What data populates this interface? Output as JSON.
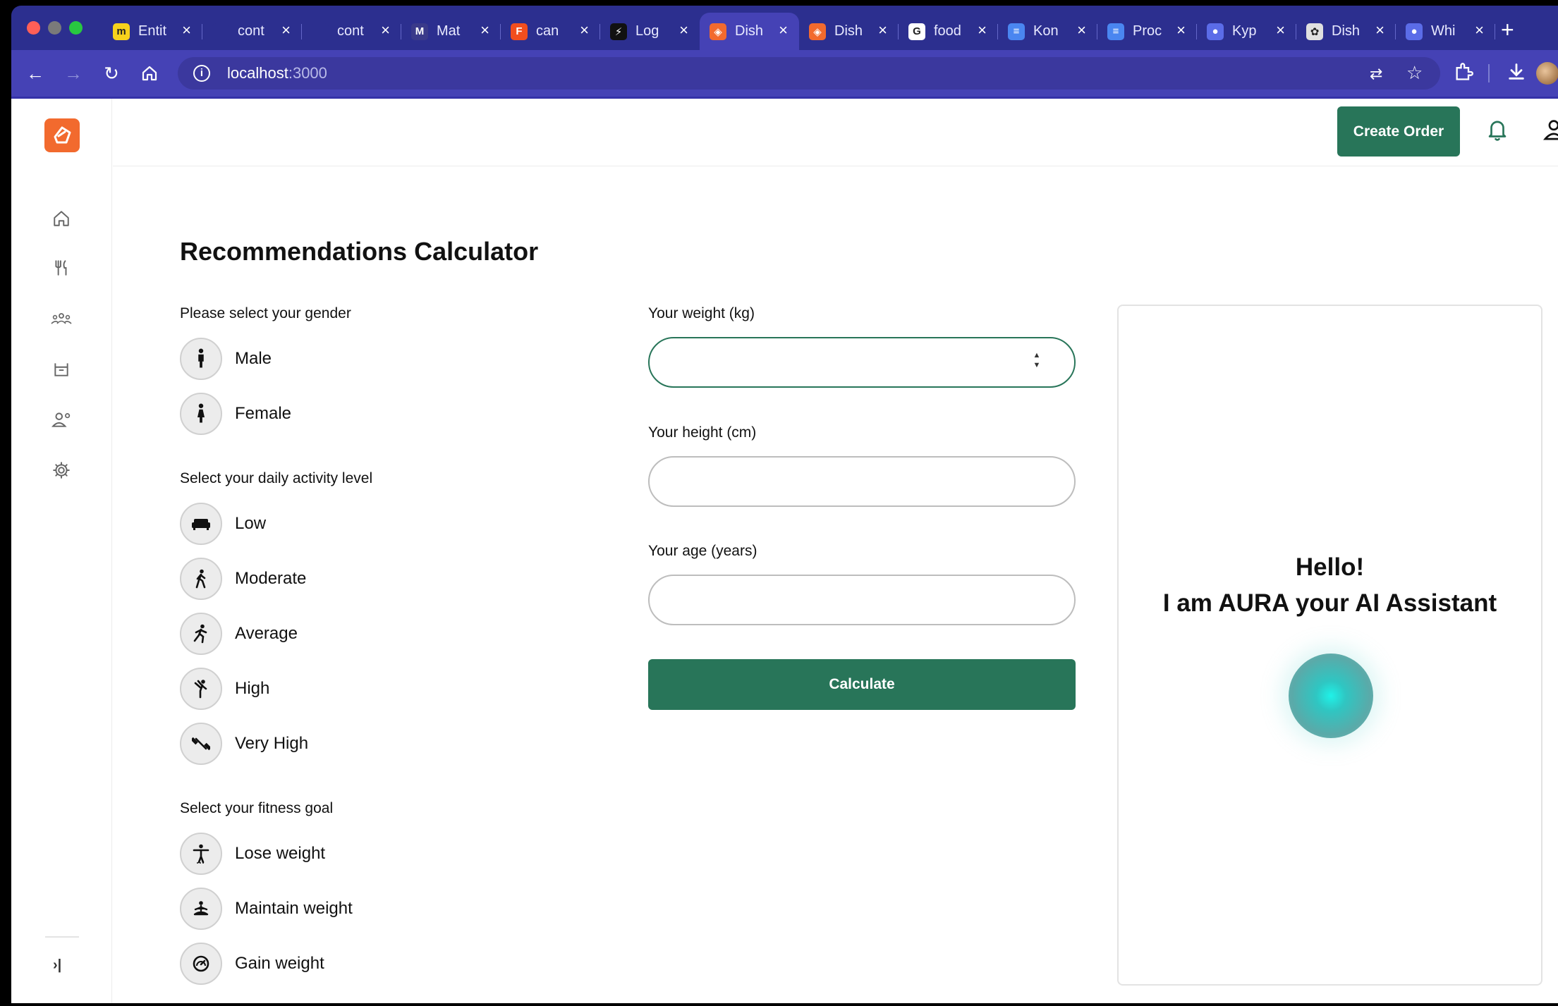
{
  "browser": {
    "tabs": [
      {
        "title": "Entit",
        "favicon": "miro-icon",
        "fav_color": "#f7d21c",
        "fav_text": "m"
      },
      {
        "title": "cont",
        "favicon": "notion-like-icon",
        "fav_color": "#2c2f8f",
        "fav_text": ""
      },
      {
        "title": "cont",
        "favicon": "notion-like-icon",
        "fav_color": "#2c2f8f",
        "fav_text": ""
      },
      {
        "title": "Mat",
        "favicon": "miro-board-icon",
        "fav_color": "#3a3a8a",
        "fav_text": "M"
      },
      {
        "title": "can",
        "favicon": "figma-icon",
        "fav_color": "#f24e1e",
        "fav_text": "F"
      },
      {
        "title": "Log",
        "favicon": "lightning-icon",
        "fav_color": "#111111",
        "fav_text": "⚡"
      },
      {
        "title": "Dish",
        "favicon": "app-logo-icon",
        "fav_color": "#f26a2e",
        "fav_text": "◈"
      },
      {
        "title": "Dish",
        "favicon": "app-logo-icon",
        "fav_color": "#f26a2e",
        "fav_text": "◈"
      },
      {
        "title": "food",
        "favicon": "google-icon",
        "fav_color": "#ffffff",
        "fav_text": "G"
      },
      {
        "title": "Kon",
        "favicon": "docs-icon",
        "fav_color": "#4a86f0",
        "fav_text": "≡"
      },
      {
        "title": "Proc",
        "favicon": "docs-icon",
        "fav_color": "#4a86f0",
        "fav_text": "≡"
      },
      {
        "title": "Kyp",
        "favicon": "chat-bubble-icon",
        "fav_color": "#5b6ce8",
        "fav_text": "●"
      },
      {
        "title": "Dish",
        "favicon": "openai-icon",
        "fav_color": "#e0e0e0",
        "fav_text": "✿"
      },
      {
        "title": "Whi",
        "favicon": "chat-bubble-icon",
        "fav_color": "#5b6ce8",
        "fav_text": "●"
      }
    ],
    "active_tab_index": 6,
    "url_host": "localhost",
    "url_port": ":3000"
  },
  "topbar": {
    "create_order_label": "Create Order"
  },
  "page": {
    "title": "Recommendations Calculator",
    "gender": {
      "label": "Please select your gender",
      "options": [
        "Male",
        "Female"
      ]
    },
    "activity": {
      "label": "Select your daily activity level",
      "options": [
        "Low",
        "Moderate",
        "Average",
        "High",
        "Very High"
      ]
    },
    "goal": {
      "label": "Select your fitness goal",
      "options": [
        "Lose weight",
        "Maintain weight",
        "Gain weight"
      ]
    },
    "form": {
      "weight_label": "Your weight (kg)",
      "weight_value": "",
      "height_label": "Your height (cm)",
      "height_value": "",
      "age_label": "Your age (years)",
      "age_value": "",
      "calculate_label": "Calculate"
    },
    "assistant": {
      "greeting": "Hello!",
      "intro": "I am AURA your AI Assistant"
    }
  },
  "colors": {
    "brand_green": "#287559",
    "browser_blue": "#4542b5",
    "logo_orange": "#f26a2e"
  }
}
